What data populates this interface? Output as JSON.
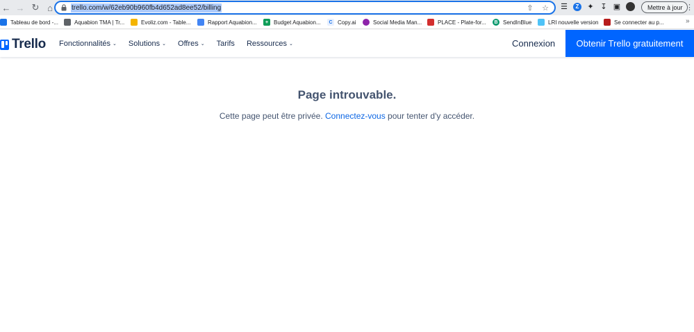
{
  "browser": {
    "url": "trello.com/w/62eb90b960fb4d652ad8ee52/billing",
    "update_label": "Mettre à jour",
    "bookmarks": [
      {
        "label": "Tableau de bord -...",
        "color": "#1a73e8"
      },
      {
        "label": "Aquabion TMA | Tr...",
        "color": "#5f6368"
      },
      {
        "label": "Evoliz.com - Table...",
        "color": "#f4b400"
      },
      {
        "label": "Rapport Aquabion...",
        "color": "#4285f4"
      },
      {
        "label": "Budget Aquabion...",
        "color": "#0f9d58"
      },
      {
        "label": "Copy.ai",
        "color": "#1a73e8"
      },
      {
        "label": "Social Media Man...",
        "color": "#8e24aa"
      },
      {
        "label": "PLACE - Plate-for...",
        "color": "#d32f2f"
      },
      {
        "label": "SendInBlue",
        "color": "#0b996e"
      },
      {
        "label": "LRI nouvelle version",
        "color": "#4fc3f7"
      },
      {
        "label": "Se connecter au p...",
        "color": "#b71c1c"
      }
    ]
  },
  "header": {
    "logo": "Trello",
    "nav": [
      {
        "label": "Fonctionnalités",
        "has_chevron": true
      },
      {
        "label": "Solutions",
        "has_chevron": true
      },
      {
        "label": "Offres",
        "has_chevron": true
      },
      {
        "label": "Tarifs",
        "has_chevron": false
      },
      {
        "label": "Ressources",
        "has_chevron": true
      }
    ],
    "login_label": "Connexion",
    "signup_label": "Obtenir Trello gratuitement"
  },
  "main": {
    "title": "Page introuvable.",
    "message_before": "Cette page peut être privée. ",
    "message_link": "Connectez-vous",
    "message_after": " pour tenter d'y accéder."
  },
  "colors": {
    "brand_blue": "#0065ff",
    "text_dark": "#172b4d",
    "text_muted": "#44546f",
    "link": "#0c66e4"
  }
}
